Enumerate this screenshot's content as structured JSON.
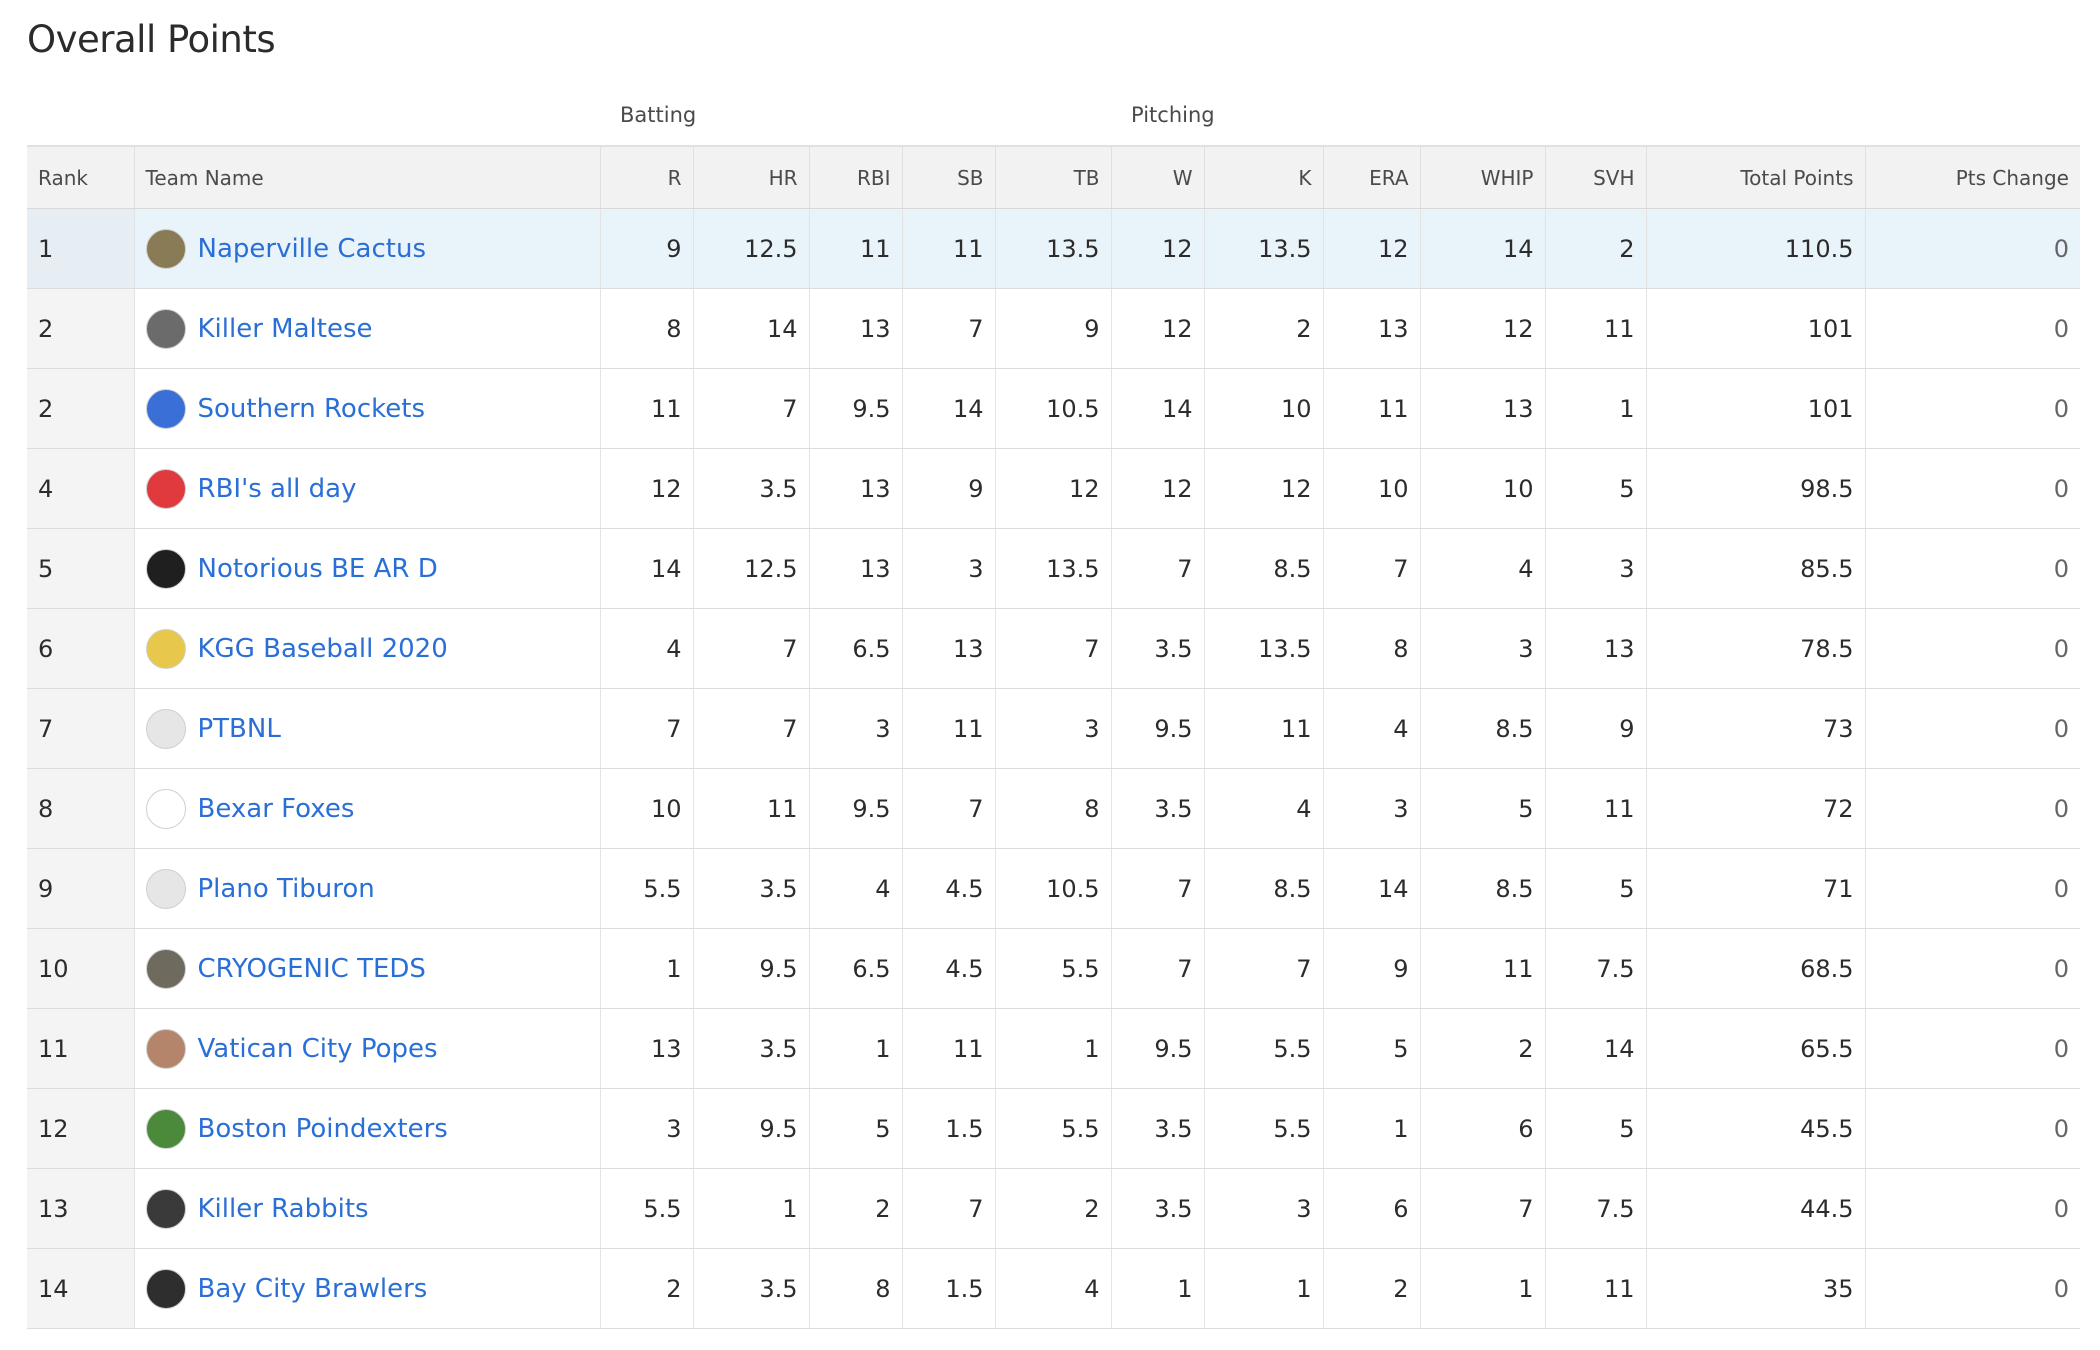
{
  "title": "Overall Points",
  "groups": {
    "batting": "Batting",
    "pitching": "Pitching"
  },
  "columns": [
    "Rank",
    "Team Name",
    "R",
    "HR",
    "RBI",
    "SB",
    "TB",
    "W",
    "K",
    "ERA",
    "WHIP",
    "SVH",
    "Total Points",
    "Pts Change"
  ],
  "rows": [
    {
      "rank": "1",
      "team": "Naperville Cactus",
      "avatar_color": "#8a7b57",
      "icon": "cactus-avatar-icon",
      "vals": [
        "9",
        "12.5",
        "11",
        "11",
        "13.5",
        "12",
        "13.5",
        "12",
        "14",
        "2"
      ],
      "total": "110.5",
      "change": "0"
    },
    {
      "rank": "2",
      "team": "Killer Maltese",
      "avatar_color": "#6b6b6b",
      "icon": "dog-avatar-icon",
      "vals": [
        "8",
        "14",
        "13",
        "7",
        "9",
        "12",
        "2",
        "13",
        "12",
        "11"
      ],
      "total": "101",
      "change": "0"
    },
    {
      "rank": "2",
      "team": "Southern Rockets",
      "avatar_color": "#3a6fd8",
      "icon": "rocket-avatar-icon",
      "vals": [
        "11",
        "7",
        "9.5",
        "14",
        "10.5",
        "14",
        "10",
        "11",
        "13",
        "1"
      ],
      "total": "101",
      "change": "0"
    },
    {
      "rank": "4",
      "team": "RBI's all day",
      "avatar_color": "#e0393e",
      "icon": "cap-avatar-icon",
      "vals": [
        "12",
        "3.5",
        "13",
        "9",
        "12",
        "12",
        "12",
        "10",
        "10",
        "5"
      ],
      "total": "98.5",
      "change": "0"
    },
    {
      "rank": "5",
      "team": "Notorious BE AR D",
      "avatar_color": "#1f1f1f",
      "icon": "bear-avatar-icon",
      "vals": [
        "14",
        "12.5",
        "13",
        "3",
        "13.5",
        "7",
        "8.5",
        "7",
        "4",
        "3"
      ],
      "total": "85.5",
      "change": "0"
    },
    {
      "rank": "6",
      "team": "KGG Baseball 2020",
      "avatar_color": "#e8c84a",
      "icon": "green-cap-avatar-icon",
      "vals": [
        "4",
        "7",
        "6.5",
        "13",
        "7",
        "3.5",
        "13.5",
        "8",
        "3",
        "13"
      ],
      "total": "78.5",
      "change": "0"
    },
    {
      "rank": "7",
      "team": "PTBNL",
      "avatar_color": "#e6e6e6",
      "icon": "yellow-cap-avatar-icon",
      "vals": [
        "7",
        "7",
        "3",
        "11",
        "3",
        "9.5",
        "11",
        "4",
        "8.5",
        "9"
      ],
      "total": "73",
      "change": "0"
    },
    {
      "rank": "8",
      "team": "Bexar Foxes",
      "avatar_color": "#ffffff",
      "icon": "fox-avatar-icon",
      "vals": [
        "10",
        "11",
        "9.5",
        "7",
        "8",
        "3.5",
        "4",
        "3",
        "5",
        "11"
      ],
      "total": "72",
      "change": "0"
    },
    {
      "rank": "9",
      "team": "Plano Tiburon",
      "avatar_color": "#e6e6e6",
      "icon": "yellow-cap-avatar-icon",
      "vals": [
        "5.5",
        "3.5",
        "4",
        "4.5",
        "10.5",
        "7",
        "8.5",
        "14",
        "8.5",
        "5"
      ],
      "total": "71",
      "change": "0"
    },
    {
      "rank": "10",
      "team": "CRYOGENIC TEDS",
      "avatar_color": "#6e6a5e",
      "icon": "jar-avatar-icon",
      "vals": [
        "1",
        "9.5",
        "6.5",
        "4.5",
        "5.5",
        "7",
        "7",
        "9",
        "11",
        "7.5"
      ],
      "total": "68.5",
      "change": "0"
    },
    {
      "rank": "11",
      "team": "Vatican City Popes",
      "avatar_color": "#b5856b",
      "icon": "pope-avatar-icon",
      "vals": [
        "13",
        "3.5",
        "1",
        "11",
        "1",
        "9.5",
        "5.5",
        "5",
        "2",
        "14"
      ],
      "total": "65.5",
      "change": "0"
    },
    {
      "rank": "12",
      "team": "Boston Poindexters",
      "avatar_color": "#4a8a3a",
      "icon": "frog-avatar-icon",
      "vals": [
        "3",
        "9.5",
        "5",
        "1.5",
        "5.5",
        "3.5",
        "5.5",
        "1",
        "6",
        "5"
      ],
      "total": "45.5",
      "change": "0"
    },
    {
      "rank": "13",
      "team": "Killer Rabbits",
      "avatar_color": "#3a3a3a",
      "icon": "rabbit-avatar-icon",
      "vals": [
        "5.5",
        "1",
        "2",
        "7",
        "2",
        "3.5",
        "3",
        "6",
        "7",
        "7.5"
      ],
      "total": "44.5",
      "change": "0"
    },
    {
      "rank": "14",
      "team": "Bay City Brawlers",
      "avatar_color": "#2e2e2e",
      "icon": "dog-avatar-icon",
      "vals": [
        "2",
        "3.5",
        "8",
        "1.5",
        "4",
        "1",
        "1",
        "2",
        "1",
        "11"
      ],
      "total": "35",
      "change": "0"
    }
  ]
}
